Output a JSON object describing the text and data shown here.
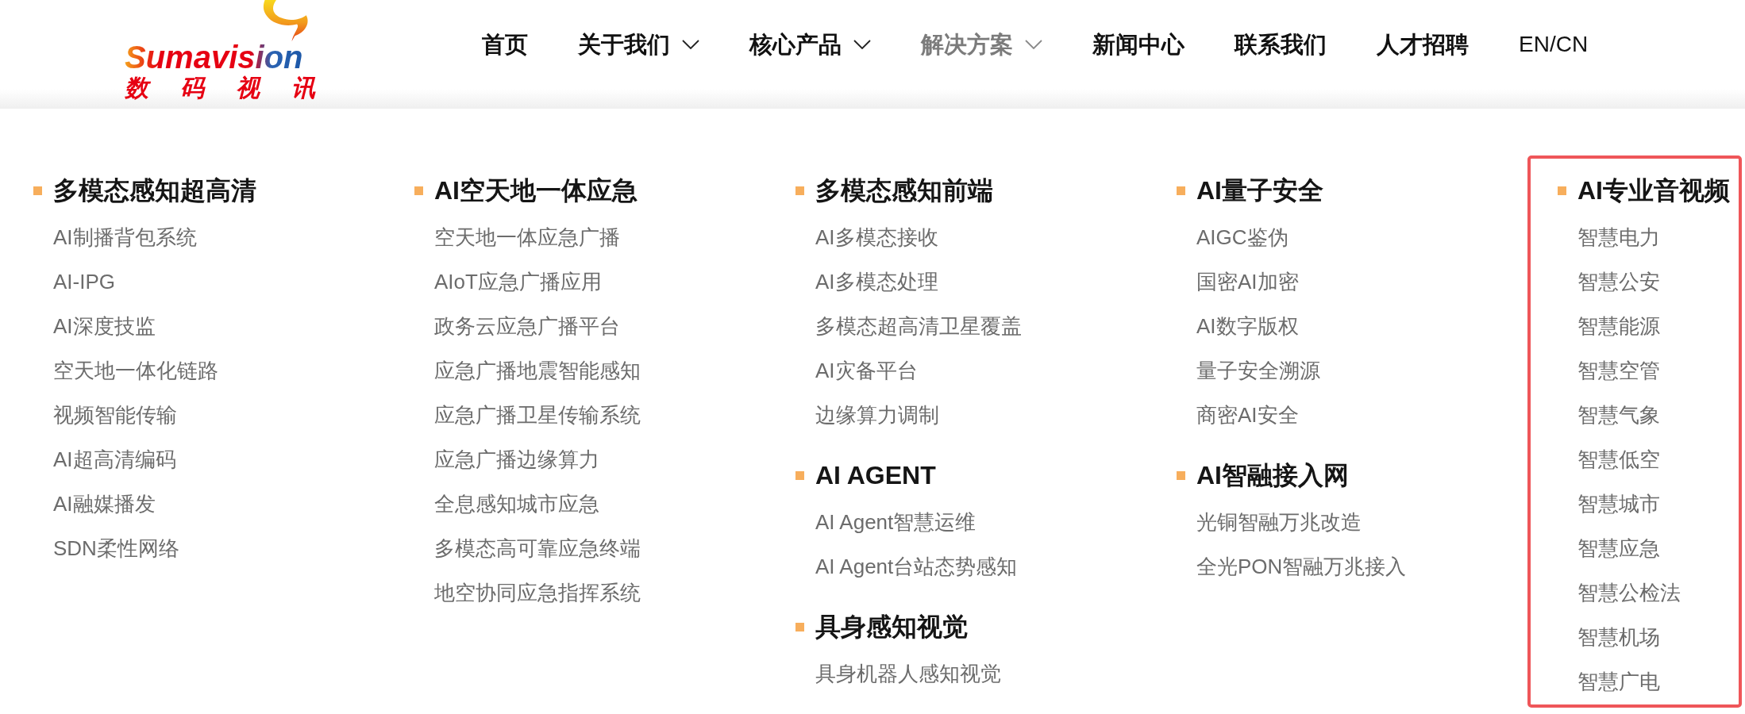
{
  "logo": {
    "wordmark": "Sumavision",
    "subtitle": "数码视讯"
  },
  "nav": [
    {
      "kind": "page",
      "label": "首页",
      "dropdown": false,
      "selected": false
    },
    {
      "kind": "page",
      "label": "关于我们",
      "dropdown": true,
      "selected": false
    },
    {
      "kind": "page",
      "label": "核心产品",
      "dropdown": true,
      "selected": false
    },
    {
      "kind": "page",
      "label": "解决方案",
      "dropdown": true,
      "selected": true
    },
    {
      "kind": "page",
      "label": "新闻中心",
      "dropdown": false,
      "selected": false
    },
    {
      "kind": "page",
      "label": "联系我们",
      "dropdown": false,
      "selected": false
    },
    {
      "kind": "page",
      "label": "人才招聘",
      "dropdown": false,
      "selected": false
    },
    {
      "kind": "language",
      "label": "EN/CN",
      "dropdown": false,
      "selected": false
    }
  ],
  "menu_columns": [
    {
      "highlighted": false,
      "groups": [
        {
          "title": "多模态感知超高清",
          "items": [
            "AI制播背包系统",
            "AI-IPG",
            "AI深度技监",
            "空天地一体化链路",
            "视频智能传输",
            "AI超高清编码",
            "AI融媒播发",
            "SDN柔性网络"
          ]
        }
      ]
    },
    {
      "highlighted": false,
      "groups": [
        {
          "title": "AI空天地一体应急",
          "items": [
            "空天地一体应急广播",
            "AIoT应急广播应用",
            "政务云应急广播平台",
            "应急广播地震智能感知",
            "应急广播卫星传输系统",
            "应急广播边缘算力",
            "全息感知城市应急",
            "多模态高可靠应急终端",
            "地空协同应急指挥系统"
          ]
        }
      ]
    },
    {
      "highlighted": false,
      "groups": [
        {
          "title": "多模态感知前端",
          "items": [
            "AI多模态接收",
            "AI多模态处理",
            "多模态超高清卫星覆盖",
            "AI灾备平台",
            "边缘算力调制"
          ]
        },
        {
          "title": "AI AGENT",
          "items": [
            "AI Agent智慧运维",
            "AI Agent台站态势感知"
          ]
        },
        {
          "title": "具身感知视觉",
          "items": [
            "具身机器人感知视觉"
          ]
        }
      ]
    },
    {
      "highlighted": false,
      "groups": [
        {
          "title": "AI量子安全",
          "items": [
            "AIGC鉴伪",
            "国密AI加密",
            "AI数字版权",
            "量子安全溯源",
            "商密AI安全"
          ]
        },
        {
          "title": "AI智融接入网",
          "items": [
            "光铜智融万兆改造",
            "全光PON智融万兆接入"
          ]
        }
      ]
    },
    {
      "highlighted": true,
      "groups": [
        {
          "title": "AI专业音视频",
          "items": [
            "智慧电力",
            "智慧公安",
            "智慧能源",
            "智慧空管",
            "智慧气象",
            "智慧低空",
            "智慧城市",
            "智慧应急",
            "智慧公检法",
            "智慧机场",
            "智慧广电"
          ]
        }
      ]
    }
  ]
}
